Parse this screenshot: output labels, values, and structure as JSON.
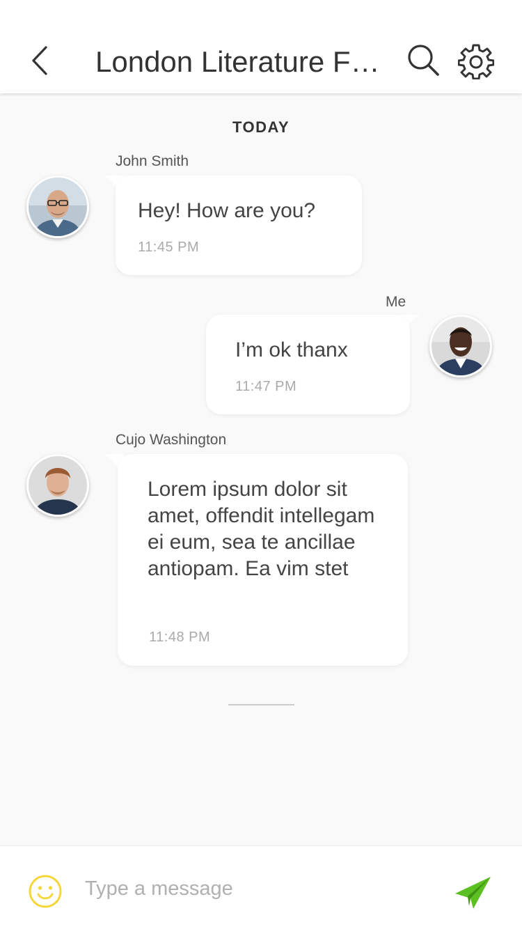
{
  "header": {
    "title": "London Literature Festival",
    "back_icon": "chevron-left-icon",
    "search_icon": "search-icon",
    "settings_icon": "gear-icon"
  },
  "chat": {
    "date_label": "TODAY",
    "messages": [
      {
        "sender": "John Smith",
        "text": "Hey! How are you?",
        "time": "11:45 PM",
        "direction": "incoming"
      },
      {
        "sender": "Me",
        "text": "I’m ok thanx",
        "time": "11:47 PM",
        "direction": "outgoing"
      },
      {
        "sender": "Cujo Washington",
        "text": "Lorem ipsum dolor sit amet, offendit intellegam ei eum, sea te ancillae antiopam. Ea vim stet",
        "time": "11:48 PM",
        "direction": "incoming"
      }
    ]
  },
  "composer": {
    "placeholder": "Type a message",
    "value": "",
    "emoji_icon": "smiley-icon",
    "send_icon": "paper-plane-icon"
  },
  "colors": {
    "background": "#f9f9f9",
    "bubble": "#ffffff",
    "emoji_accent": "#f5d63b",
    "send_accent": "#5cc022"
  }
}
